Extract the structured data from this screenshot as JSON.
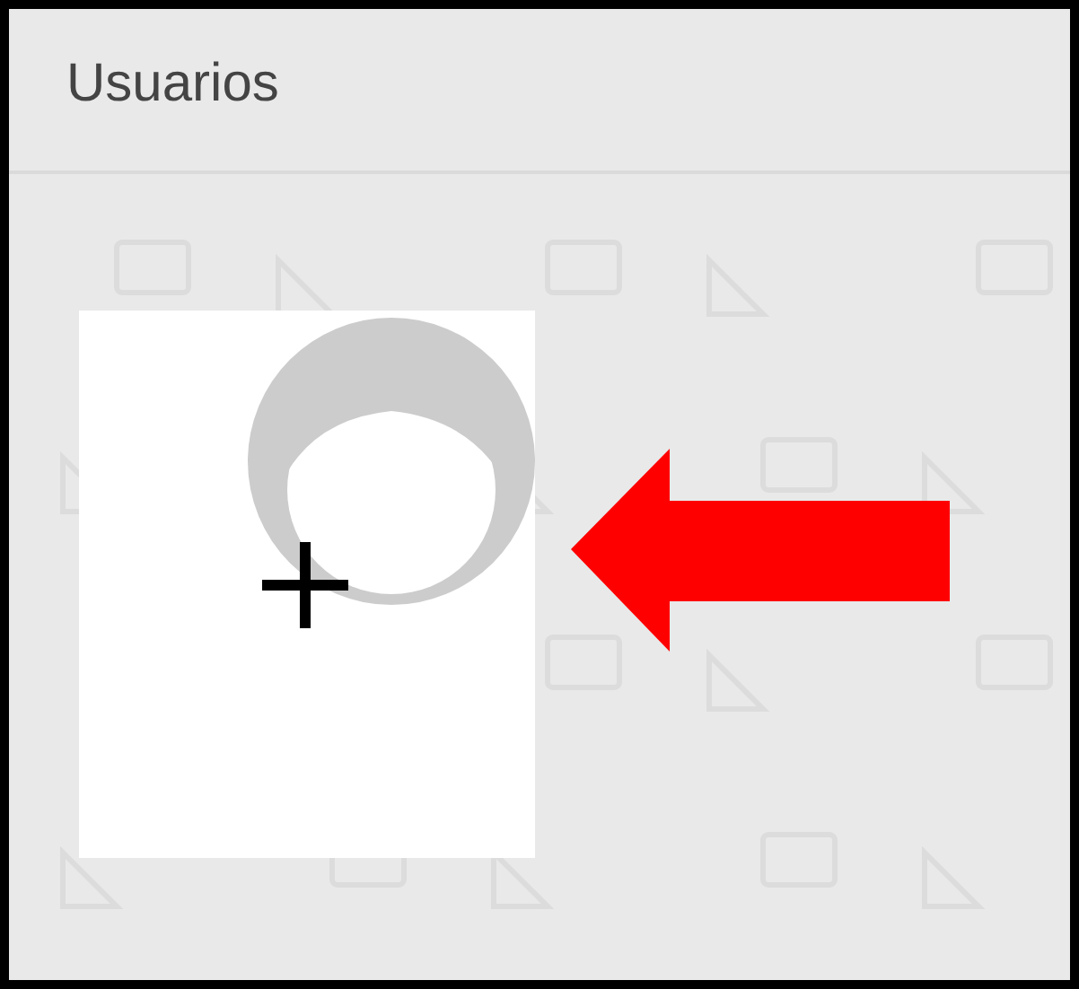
{
  "header": {
    "title": "Usuarios"
  }
}
